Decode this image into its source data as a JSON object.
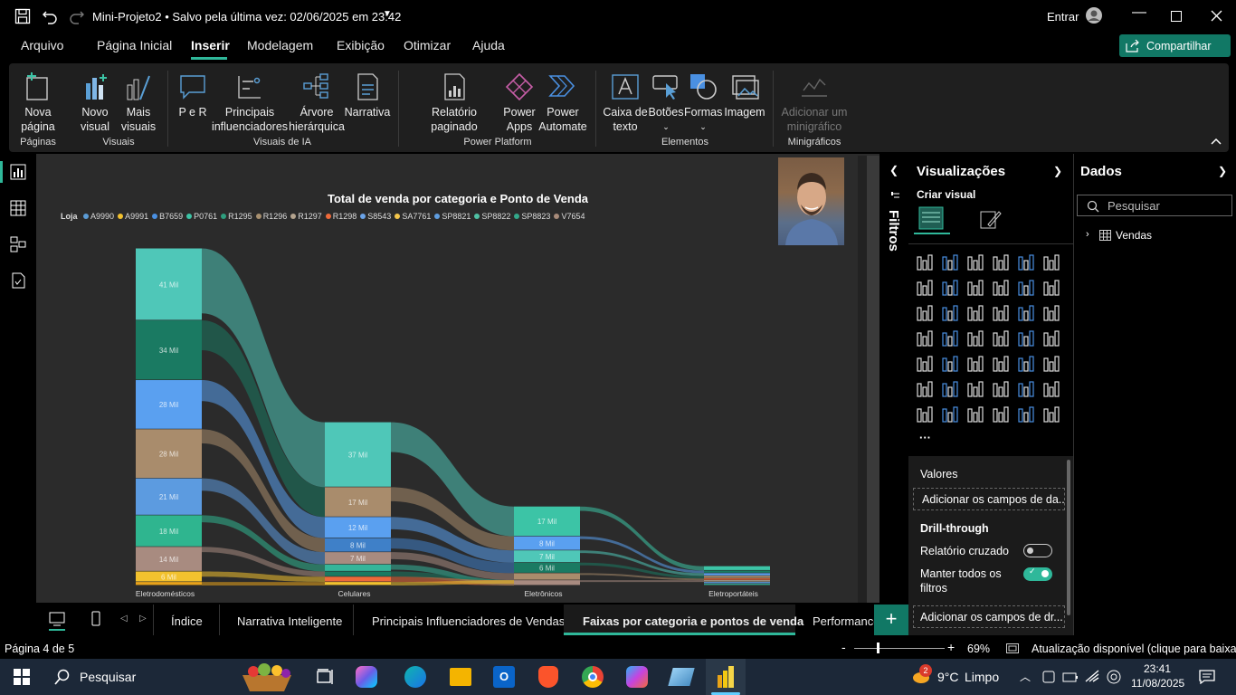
{
  "titlebar": {
    "title": "Mini-Projeto2 • Salvo pela última vez: 02/06/2025 em 23:42",
    "user_label": "Entrar"
  },
  "menu": {
    "tabs": [
      "Arquivo",
      "Página Inicial",
      "Inserir",
      "Modelagem",
      "Exibição",
      "Otimizar",
      "Ajuda"
    ],
    "active": "Inserir",
    "share_label": "Compartilhar"
  },
  "ribbon": {
    "buttons": {
      "nova_pagina": "Nova página",
      "novo_visual": "Novo visual",
      "mais_visuais": "Mais visuais",
      "p_e_r": "P e R",
      "principais": "Principais influenciadores",
      "arvore": "Árvore hierárquica",
      "narrativa": "Narrativa",
      "relatorio": "Relatório paginado",
      "power_apps": "Power Apps",
      "power_automate": "Power Automate",
      "caixa_texto": "Caixa de texto",
      "botoes": "Botões",
      "formas": "Formas",
      "imagem": "Imagem",
      "minigrafico": "Adicionar um minigráfico"
    },
    "groups": {
      "paginas": "Páginas",
      "visuais": "Visuais",
      "visuais_ia": "Visuais de IA",
      "power_platform": "Power Platform",
      "elementos": "Elementos",
      "minigraficos": "Minigráficos"
    }
  },
  "chart_data": {
    "type": "sankey",
    "title": "Total de venda por categoria e Ponto de Venda",
    "legend_title": "Loja",
    "legend": [
      {
        "name": "A9990",
        "color": "#5b9bd5"
      },
      {
        "name": "A9991",
        "color": "#f2c12e"
      },
      {
        "name": "B7659",
        "color": "#4a90e2"
      },
      {
        "name": "P0761",
        "color": "#3cc4a6"
      },
      {
        "name": "R1295",
        "color": "#2e9e7e"
      },
      {
        "name": "R1296",
        "color": "#a89070"
      },
      {
        "name": "R1297",
        "color": "#b4a38e"
      },
      {
        "name": "R1298",
        "color": "#ef6a3a"
      },
      {
        "name": "S8543",
        "color": "#6aa3e8"
      },
      {
        "name": "SA7761",
        "color": "#f4c64a"
      },
      {
        "name": "SP8821",
        "color": "#5f9de0"
      },
      {
        "name": "SP8822",
        "color": "#4fc1a4"
      },
      {
        "name": "SP8823",
        "color": "#33a88a"
      },
      {
        "name": "V7654",
        "color": "#a88b7a"
      }
    ],
    "categories": [
      "Eletrodomésticos",
      "Celulares",
      "Eletrônicos",
      "Eletroportáteis"
    ],
    "stacks": [
      {
        "category": "Eletrodomésticos",
        "segments": [
          {
            "label": "41 Mil",
            "value": 41,
            "color": "#4fc7b8"
          },
          {
            "label": "34 Mil",
            "value": 34,
            "color": "#1a7a62"
          },
          {
            "label": "28 Mil",
            "value": 28,
            "color": "#5aa0f0"
          },
          {
            "label": "28 Mil",
            "value": 28,
            "color": "#a98c6c"
          },
          {
            "label": "21 Mil",
            "value": 21,
            "color": "#5c9be0"
          },
          {
            "label": "18 Mil",
            "value": 18,
            "color": "#2fb58f"
          },
          {
            "label": "14 Mil",
            "value": 14,
            "color": "#a88b80"
          },
          {
            "label": "6 Mil",
            "value": 6,
            "color": "#f2c12e"
          },
          {
            "label": "",
            "value": 2,
            "color": "#e8a21a"
          }
        ]
      },
      {
        "category": "Celulares",
        "segments": [
          {
            "label": "37 Mil",
            "value": 37,
            "color": "#4fc7b8"
          },
          {
            "label": "17 Mil",
            "value": 17,
            "color": "#a98c6c"
          },
          {
            "label": "12 Mil",
            "value": 12,
            "color": "#5aa0f0"
          },
          {
            "label": "8 Mil",
            "value": 8,
            "color": "#3f80c8"
          },
          {
            "label": "7 Mil",
            "value": 7,
            "color": "#a88b80"
          },
          {
            "label": "",
            "value": 4,
            "color": "#35b59a"
          },
          {
            "label": "",
            "value": 3,
            "color": "#1a7a62"
          },
          {
            "label": "",
            "value": 3,
            "color": "#ef6a3a"
          },
          {
            "label": "",
            "value": 2,
            "color": "#f2c12e"
          }
        ]
      },
      {
        "category": "Eletrônicos",
        "segments": [
          {
            "label": "17 Mil",
            "value": 17,
            "color": "#3cc4a6"
          },
          {
            "label": "8 Mil",
            "value": 8,
            "color": "#5aa0f0"
          },
          {
            "label": "7 Mil",
            "value": 7,
            "color": "#4fc7b8"
          },
          {
            "label": "6 Mil",
            "value": 6,
            "color": "#1a7a62"
          },
          {
            "label": "",
            "value": 4,
            "color": "#a98c6c"
          },
          {
            "label": "",
            "value": 3,
            "color": "#a88b80"
          }
        ]
      },
      {
        "category": "Eletroportáteis",
        "segments": [
          {
            "label": "",
            "value": 2.5,
            "color": "#3cc4a6"
          },
          {
            "label": "",
            "value": 1.5,
            "color": "#1a7a62"
          },
          {
            "label": "",
            "value": 1.5,
            "color": "#5aa0f0"
          },
          {
            "label": "",
            "value": 1.5,
            "color": "#a98c6c"
          },
          {
            "label": "",
            "value": 1,
            "color": "#ef6a3a"
          },
          {
            "label": "",
            "value": 1,
            "color": "#b4a38e"
          },
          {
            "label": "",
            "value": 1,
            "color": "#5c9be0"
          },
          {
            "label": "",
            "value": 1,
            "color": "#33a88a"
          }
        ]
      }
    ]
  },
  "filters": {
    "label": "Filtros"
  },
  "visualizations": {
    "title": "Visualizações",
    "subtitle": "Criar visual",
    "more": "···",
    "valores_label": "Valores",
    "valores_placeholder": "Adicionar os campos de da...",
    "drill_label": "Drill-through",
    "relatorio_cruzado": "Relatório cruzado",
    "relatorio_cruzado_on": false,
    "manter_filtros": "Manter todos os filtros",
    "manter_filtros_on": true,
    "drill_placeholder": "Adicionar os campos de dr..."
  },
  "data_pane": {
    "title": "Dados",
    "search_placeholder": "Pesquisar",
    "tables": [
      "Vendas"
    ]
  },
  "page_tabs": {
    "tabs": [
      "Índice",
      "Narrativa Inteligente",
      "Principais Influenciadores de Vendas",
      "Faixas por categoria e pontos de venda",
      "Performance"
    ],
    "active": "Faixas por categoria e pontos de venda"
  },
  "status": {
    "page": "Página 4 de 5",
    "zoom": "69%",
    "zoom_fraction": 0.69,
    "update": "Atualização disponível (clique para baixar)"
  },
  "taskbar": {
    "search": "Pesquisar",
    "weather_temp": "9°C",
    "weather_text": "Limpo",
    "weather_badge": "2",
    "time": "23:41",
    "date": "11/08/2025",
    "icons": [
      "copilot-icon",
      "edge-icon",
      "files-icon",
      "outlook-icon",
      "brave-icon",
      "chrome-icon",
      "m365-icon",
      "app-icon",
      "powerbi-icon"
    ]
  }
}
